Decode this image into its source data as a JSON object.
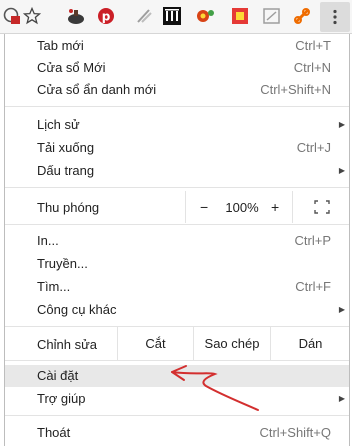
{
  "toolbar": {
    "icons": [
      "page-info-icon",
      "star-icon",
      "lab-icon",
      "pinterest-icon",
      "pen-icon",
      "archive-icon",
      "flower-icon",
      "red-square-icon",
      "gray-square-icon",
      "orange-link-icon"
    ],
    "menu_icon": "more-vert-icon"
  },
  "menu": {
    "new_tab": {
      "label": "Tab mới",
      "shortcut": "Ctrl+T"
    },
    "new_window": {
      "label": "Cửa sổ Mới",
      "shortcut": "Ctrl+N"
    },
    "incognito": {
      "label": "Cửa sổ ẩn danh mới",
      "shortcut": "Ctrl+Shift+N"
    },
    "history": {
      "label": "Lịch sử"
    },
    "downloads": {
      "label": "Tải xuống",
      "shortcut": "Ctrl+J"
    },
    "bookmarks": {
      "label": "Dấu trang"
    },
    "zoom": {
      "label": "Thu phóng",
      "minus": "−",
      "value": "100%",
      "plus": "+"
    },
    "print": {
      "label": "In...",
      "shortcut": "Ctrl+P"
    },
    "cast": {
      "label": "Truyền..."
    },
    "find": {
      "label": "Tìm...",
      "shortcut": "Ctrl+F"
    },
    "more_tools": {
      "label": "Công cụ khác"
    },
    "edit": {
      "label": "Chỉnh sửa",
      "cut": "Cắt",
      "copy": "Sao chép",
      "paste": "Dán"
    },
    "settings": {
      "label": "Cài đặt"
    },
    "help": {
      "label": "Trợ giúp"
    },
    "exit": {
      "label": "Thoát",
      "shortcut": "Ctrl+Shift+Q"
    }
  },
  "colors": {
    "annotation_arrow": "#d32f2f",
    "highlight": "#e8e8e8"
  }
}
